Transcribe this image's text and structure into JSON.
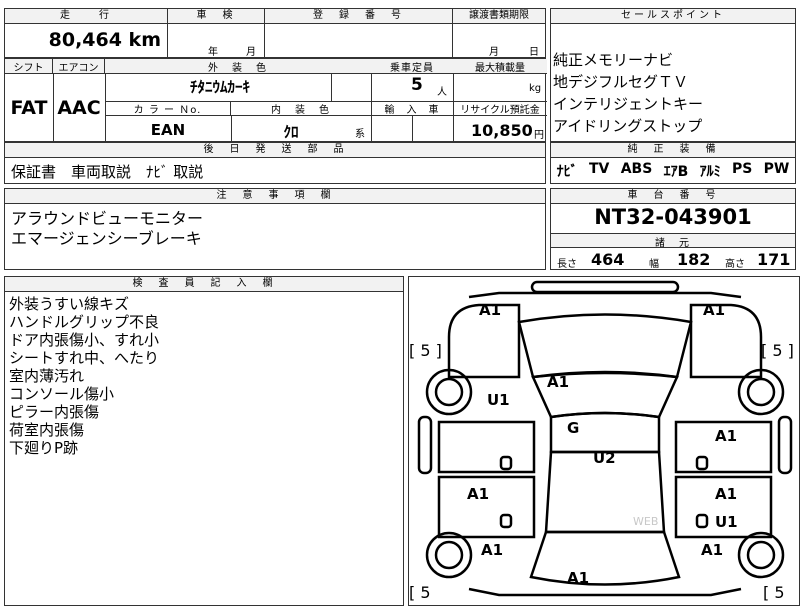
{
  "top": {
    "mileage_header": "走　　行",
    "mileage_value": "80,464 km",
    "inspection_header": "車　検",
    "inspection_year": "年",
    "inspection_month": "月",
    "registration_header": "登　録　番　号",
    "transfer_header": "譲渡書類期限",
    "transfer_month": "月",
    "transfer_day": "日",
    "sales_header": "セールスポイント"
  },
  "row2": {
    "shift_header": "シフト",
    "shift_value": "FAT",
    "ac_header": "エアコン",
    "ac_value": "AAC",
    "exterior_header": "外　装　色",
    "exterior_value": "ﾁﾀﾆｳﾑｶｰｷ",
    "color_no_header": "カ ラ ー Ｎo.",
    "color_no_value": "EAN",
    "interior_header": "内　装　色",
    "interior_value": "ｸﾛ",
    "interior_suffix": "系",
    "capacity_header": "乗車定員",
    "capacity_value": "5",
    "capacity_unit": "人",
    "import_header": "輸　入　車",
    "max_load_header": "最大積載量",
    "max_load_unit": "kg",
    "recycle_header": "リサイクル預託金",
    "recycle_value": "10,850",
    "recycle_unit": "円"
  },
  "sales_points": [
    "純正メモリーナビ",
    "地デジフルセグＴＶ",
    "インテリジェントキー",
    "アイドリングストップ"
  ],
  "parts": {
    "header": "後　日　発　送　部　品",
    "value": "保証書　車両取説　ﾅﾋﾞ 取説"
  },
  "equipment": {
    "header": "純　正　装　備",
    "items": [
      "ﾅﾋﾞ",
      "TV",
      "ABS",
      "ｴｱB",
      "ｱﾙﾐ",
      "PS",
      "PW"
    ]
  },
  "notes": {
    "header": "注　意　事　項　欄",
    "lines": [
      "アラウンドビューモニター",
      "エマージェンシーブレーキ"
    ]
  },
  "chassis": {
    "header": "車　台　番　号",
    "value": "NT32-043901",
    "specs_header": "諸　元",
    "length_label": "長さ",
    "length_value": "464",
    "width_label": "幅",
    "width_value": "182",
    "height_label": "高さ",
    "height_value": "171"
  },
  "inspector": {
    "header": "検　査　員　記　入　欄",
    "lines": [
      "外装うすい線キズ",
      "ハンドルグリップ不良",
      "ドア内張傷小、すれ小",
      "シートすれ中、へたり",
      "室内薄汚れ",
      "コンソール傷小",
      "ピラー内張傷",
      "荷室内張傷",
      "下廻りP跡"
    ]
  },
  "diagram": {
    "marks": [
      "A1",
      "A1",
      "A1",
      "U1",
      "G",
      "U2",
      "A1",
      "A1",
      "A1",
      "A1",
      "U1",
      "A1",
      "A1"
    ],
    "tires": [
      "[ 5 ]",
      "[ 5 ]",
      "[ 5",
      "[ 5"
    ],
    "watermark": "WEB"
  }
}
